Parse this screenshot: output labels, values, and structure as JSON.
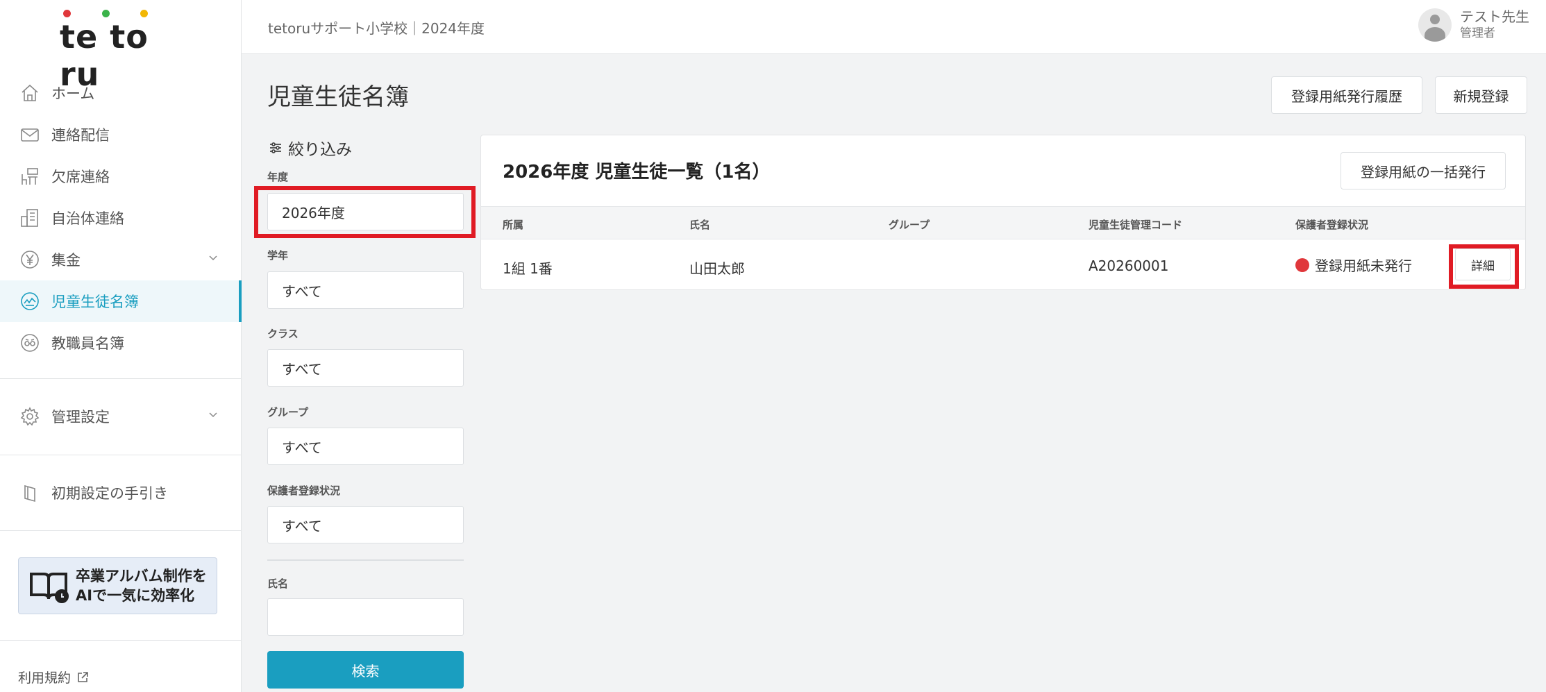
{
  "logo": {
    "text": "te to ru",
    "dot_colors": [
      "#e0373b",
      "#3bb34a",
      "#f2b705"
    ]
  },
  "sidebar": {
    "items": [
      {
        "label": "ホーム",
        "icon": "home-icon"
      },
      {
        "label": "連絡配信",
        "icon": "mail-icon"
      },
      {
        "label": "欠席連絡",
        "icon": "desk-icon"
      },
      {
        "label": "自治体連絡",
        "icon": "building-icon"
      },
      {
        "label": "集金",
        "icon": "yen-icon",
        "expandable": true
      },
      {
        "label": "児童生徒名簿",
        "icon": "student-roster-icon",
        "active": true
      },
      {
        "label": "教職員名簿",
        "icon": "teacher-roster-icon"
      }
    ],
    "settings_label": "管理設定",
    "guide_label": "初期設定の手引き",
    "banner_line1": "卒業アルバム制作を",
    "banner_line2": "AIで一気に効率化",
    "terms_label": "利用規約"
  },
  "header": {
    "school": "tetoruサポート小学校｜2024年度",
    "user_name": "テスト先生",
    "user_role": "管理者"
  },
  "main": {
    "title": "児童生徒名簿",
    "history_button": "登録用紙発行履歴",
    "new_button": "新規登録"
  },
  "filter": {
    "title": "絞り込み",
    "year_label": "年度",
    "year_value": "2026年度",
    "grade_label": "学年",
    "grade_value": "すべて",
    "class_label": "クラス",
    "class_value": "すべて",
    "group_label": "グループ",
    "group_value": "すべて",
    "guardian_label": "保護者登録状況",
    "guardian_value": "すべて",
    "name_label": "氏名",
    "name_value": "",
    "search_button": "検索"
  },
  "list": {
    "title": "2026年度 児童生徒一覧（1名）",
    "bulk_button": "登録用紙の一括発行",
    "columns": [
      "所属",
      "氏名",
      "グループ",
      "児童生徒管理コード",
      "保護者登録状況"
    ],
    "rows": [
      {
        "affiliation": "1組 1番",
        "name": "山田太郎",
        "group": "",
        "code": "A20260001",
        "status": "登録用紙未発行",
        "status_color": "#e0373b",
        "detail": "詳細"
      }
    ]
  },
  "highlight_color": "#e01b24",
  "accent_color": "#1a9ec0"
}
